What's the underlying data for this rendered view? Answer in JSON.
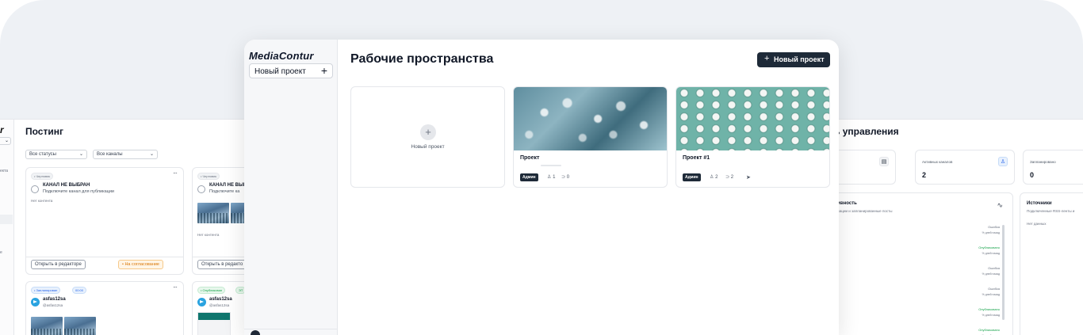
{
  "left_app": {
    "logo": "r",
    "title": "Постинг",
    "side_items": [
      "екта",
      "е"
    ],
    "filters": {
      "status": "Все статусы",
      "channels": "Все каналы"
    },
    "cards": [
      {
        "status": "• Черновик",
        "channel": "КАНАЛ НЕ ВЫБРАН",
        "channel_hint": "Подключите канал для публикации",
        "content": "Нет контента",
        "open_btn": "Открыть в редакторе",
        "approve_btn": "• На согласование"
      },
      {
        "status": "• Черновик",
        "channel": "КАНАЛ НЕ ВЫБ",
        "channel_hint": "Подключите ка",
        "content": "Нет контента",
        "open_btn": "Открыть в редакто"
      },
      {
        "status": "• Запланирован",
        "time": "00:00",
        "channel": "asfas12sa",
        "handle": "@asfas12sa"
      },
      {
        "status": "• Опубликован",
        "extra": "ЭТ",
        "channel": "asfas12sa",
        "handle": "@asfas12sa"
      }
    ]
  },
  "main": {
    "logo": "MediaContur",
    "sidebar_new_project": "Новый проект",
    "sidebar_new_icon": "plus-icon",
    "page_title": "Рабочие пространства",
    "primary_btn": "Новый проект",
    "new_card_label": "Новый проект",
    "workspaces": [
      {
        "name": "Проект",
        "role": "Админ",
        "members": "1",
        "feeds": "0",
        "has_tg": false
      },
      {
        "name": "Проект #1",
        "role": "Админ",
        "members": "2",
        "feeds": "2",
        "has_tg": true
      }
    ]
  },
  "right_app": {
    "title": "ь управления",
    "stats": [
      {
        "label": "",
        "value": "",
        "icon": "document-icon"
      },
      {
        "label": "Активных каналов",
        "value": "2",
        "icon": "users-icon"
      },
      {
        "label": "Запланировано",
        "value": "0",
        "icon": ""
      }
    ],
    "activity": {
      "title": "активность",
      "subtitle": "убликации и запланированные посты",
      "rows": [
        {
          "date": "м 9 июля",
          "status": "Ошибка",
          "ago": "% дней назад",
          "ok": false
        },
        {
          "date": "м 9 июля",
          "status": "Опубликовано",
          "ago": "% дней назад",
          "ok": true
        },
        {
          "date": "м 9 июля",
          "status": "Ошибка",
          "ago": "% дней назад",
          "ok": false
        },
        {
          "date": "м 9 июля",
          "status": "Ошибка",
          "ago": "% дней назад",
          "ok": false
        },
        {
          "date": "м 9 июля",
          "status": "Опубликовано",
          "ago": "% дней назад",
          "ok": true
        },
        {
          "date": "м 9 июля",
          "status": "Опубликовано",
          "ago": "% дней назад",
          "ok": true
        }
      ]
    },
    "sources": {
      "title": "Источники",
      "subtitle": "Подключенные RSS-ленты и",
      "empty": "Нет данных"
    }
  },
  "colors": {
    "primary": "#1e2a38",
    "telegram": "#2aa3e0",
    "success": "#16a34a",
    "warning": "#d97706"
  }
}
